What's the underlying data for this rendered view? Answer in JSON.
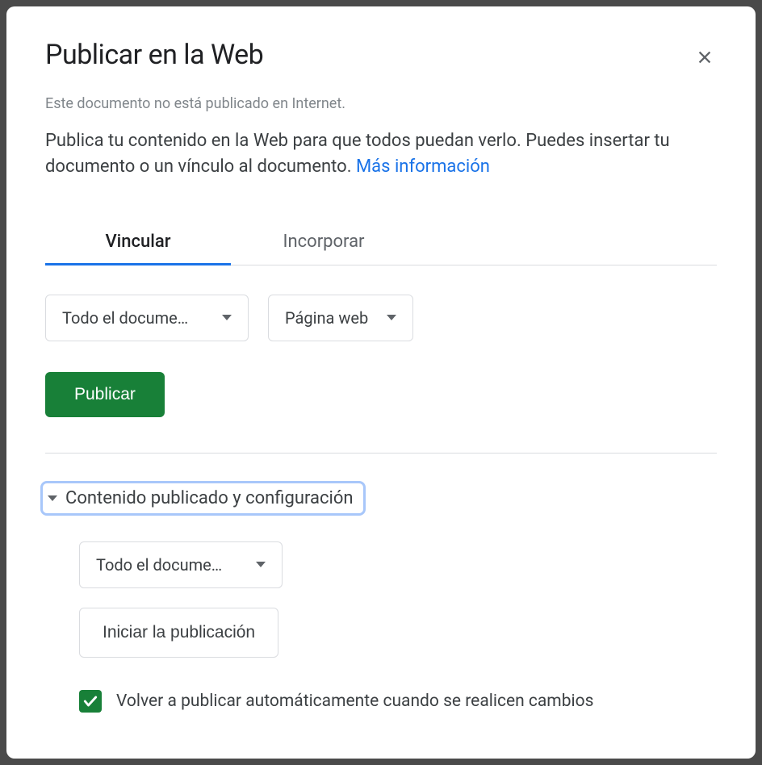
{
  "dialog": {
    "title": "Publicar en la Web",
    "status": "Este documento no está publicado en Internet.",
    "description": "Publica tu contenido en la Web para que todos puedan verlo. Puedes insertar tu documento o un vínculo al documento. ",
    "learn_more": "Más información"
  },
  "tabs": {
    "link": "Vincular",
    "embed": "Incorporar"
  },
  "selects": {
    "scope": "Todo el docume…",
    "format": "Página web"
  },
  "buttons": {
    "publish": "Publicar",
    "start_publishing": "Iniciar la publicación"
  },
  "settings": {
    "header": "Contenido publicado y configuración",
    "scope": "Todo el docume…",
    "auto_republish": "Volver a publicar automáticamente cuando se realicen cambios"
  }
}
